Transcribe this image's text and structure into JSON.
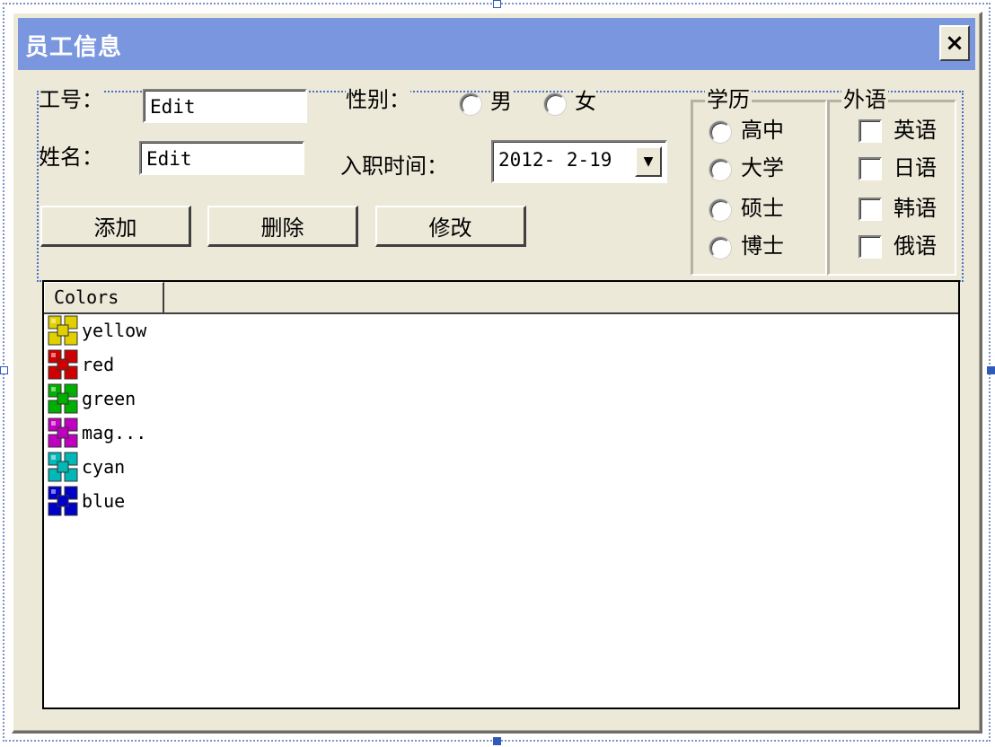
{
  "dialog": {
    "title": "员工信息",
    "close_label": "×"
  },
  "form": {
    "employee_id_label": "工号：",
    "employee_id_value": "Edit",
    "name_label": "姓名：",
    "name_value": "Edit",
    "gender_label": "性别：",
    "gender_options": [
      "男",
      "女"
    ],
    "hire_date_label": "入职时间：",
    "hire_date_value": "2012- 2-19",
    "buttons": {
      "add": "添加",
      "delete": "删除",
      "modify": "修改"
    }
  },
  "education": {
    "title": "学历",
    "options": [
      "高中",
      "大学",
      "硕士",
      "博士"
    ]
  },
  "languages": {
    "title": "外语",
    "options": [
      "英语",
      "日语",
      "韩语",
      "俄语"
    ]
  },
  "list": {
    "column_header": "Colors",
    "items": [
      {
        "label": "yellow",
        "color": "#e0d000"
      },
      {
        "label": "red",
        "color": "#d00000"
      },
      {
        "label": "green",
        "color": "#00b000"
      },
      {
        "label": "mag...",
        "color": "#c000c0"
      },
      {
        "label": "cyan",
        "color": "#00b8b8"
      },
      {
        "label": "blue",
        "color": "#0000c8"
      }
    ]
  }
}
